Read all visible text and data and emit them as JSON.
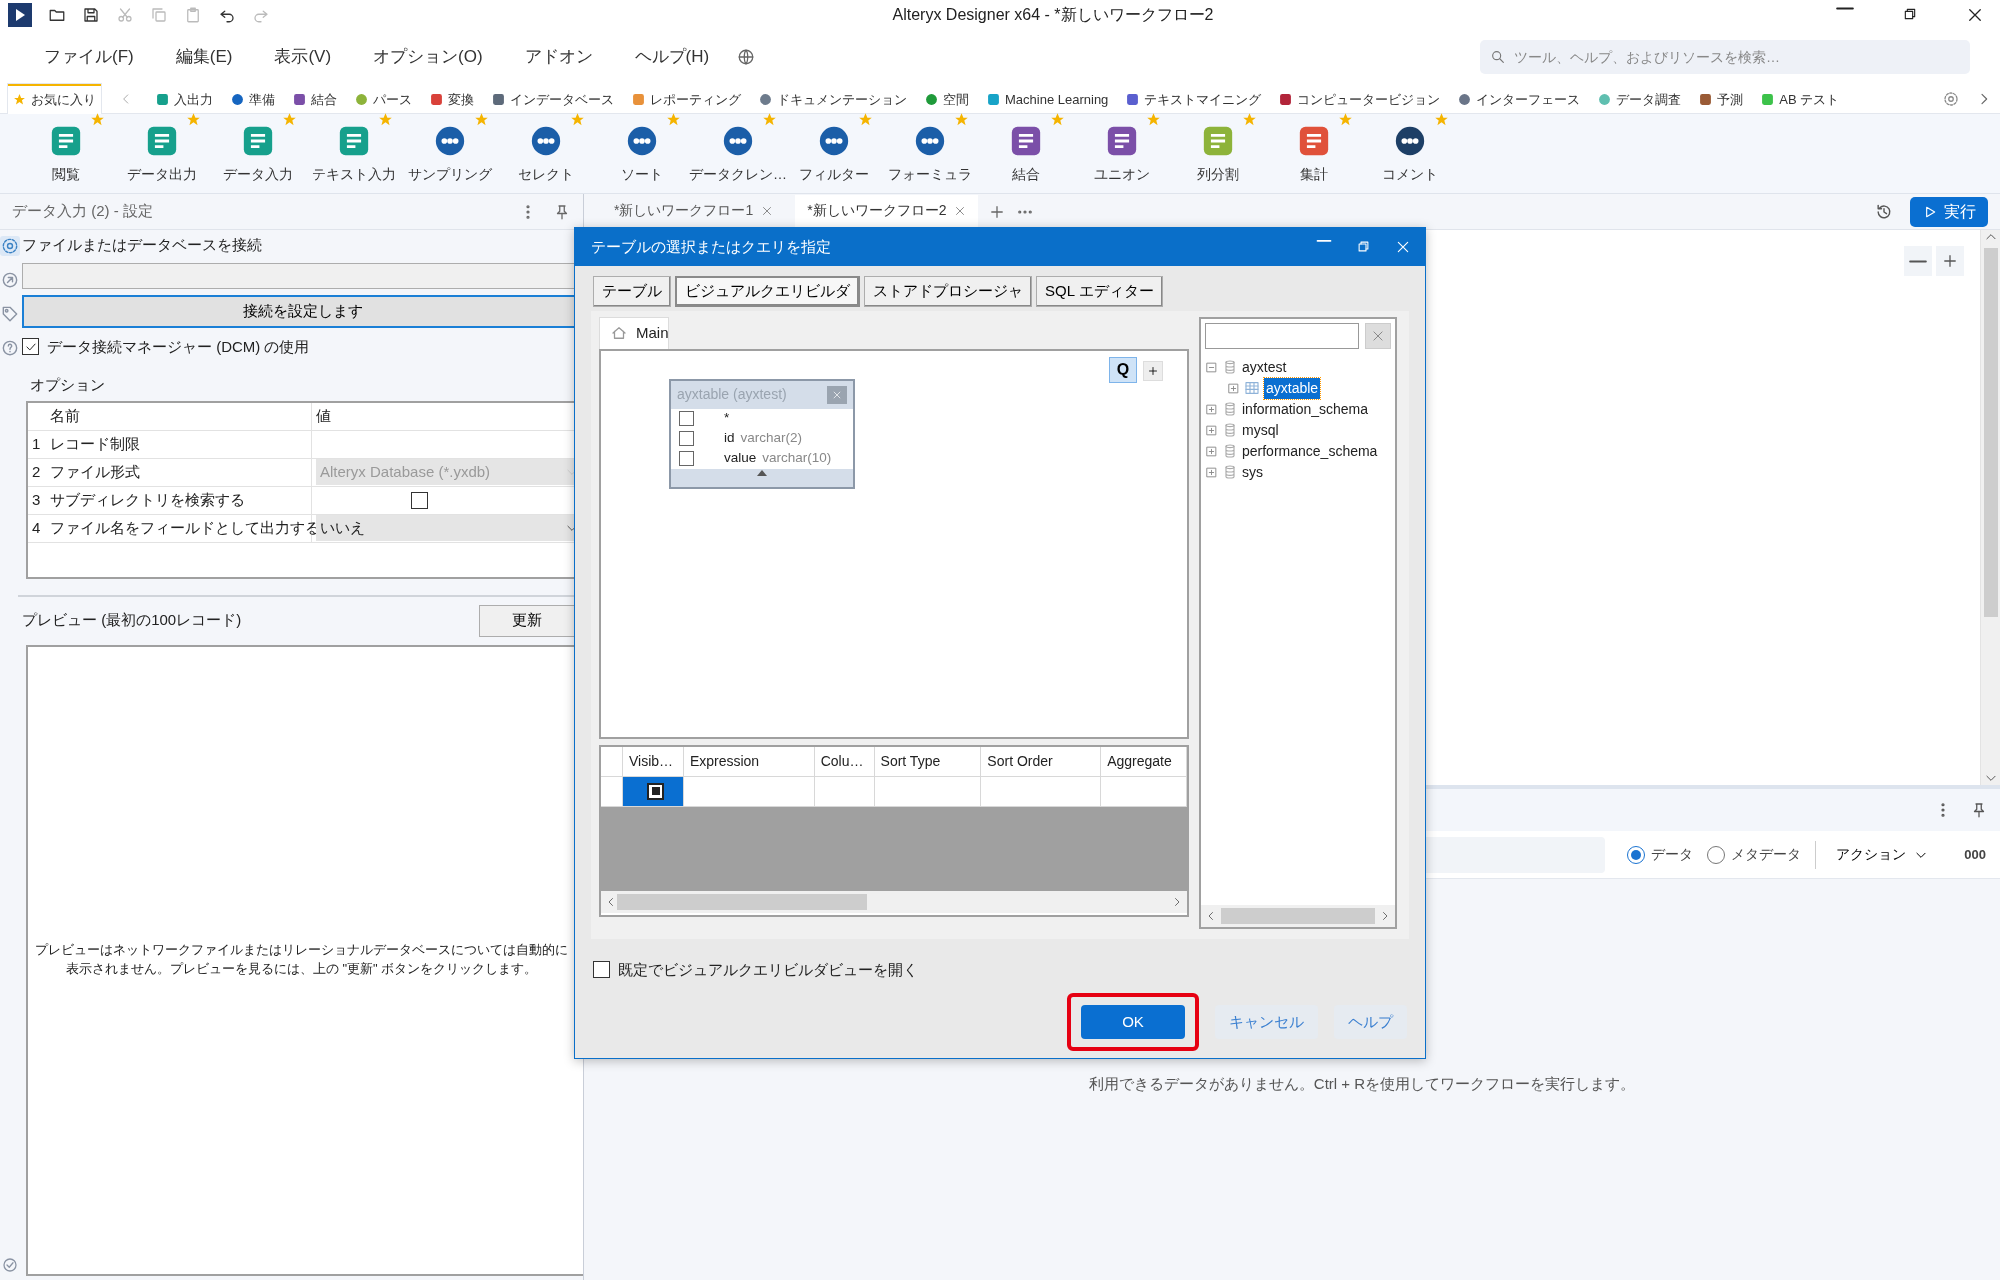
{
  "window": {
    "title": "Alteryx Designer x64 - *新しいワークフロー2"
  },
  "quick_access": [
    {
      "kind": "folder",
      "disabled": false
    },
    {
      "kind": "save",
      "disabled": false
    },
    {
      "kind": "cut",
      "disabled": true
    },
    {
      "kind": "copy",
      "disabled": true
    },
    {
      "kind": "paste",
      "disabled": true
    },
    {
      "kind": "undo",
      "disabled": false
    },
    {
      "kind": "redo",
      "disabled": true
    }
  ],
  "menu": [
    "ファイル(F)",
    "編集(E)",
    "表示(V)",
    "オプション(O)",
    "アドオン",
    "ヘルプ(H)"
  ],
  "search": {
    "placeholder": "ツール、ヘルプ、およびリソースを検索…"
  },
  "categories": [
    {
      "label": "お気に入り",
      "kind": "star",
      "color": "#f5b400",
      "selected": true
    },
    {
      "label": "入出力",
      "kind": "square",
      "color": "#16a08c",
      "selected": false
    },
    {
      "label": "準備",
      "kind": "circle",
      "color": "#1565c0",
      "selected": false
    },
    {
      "label": "結合",
      "kind": "square",
      "color": "#7b4fa8",
      "selected": false
    },
    {
      "label": "パース",
      "kind": "circle",
      "color": "#8db33a",
      "selected": false
    },
    {
      "label": "変換",
      "kind": "square",
      "color": "#d9413a",
      "selected": false
    },
    {
      "label": "インデータベース",
      "kind": "square",
      "color": "#5d6a7a",
      "selected": false
    },
    {
      "label": "レポーティング",
      "kind": "square",
      "color": "#e8913a",
      "selected": false
    },
    {
      "label": "ドキュメンテーション",
      "kind": "circle",
      "color": "#6d7b8c",
      "selected": false
    },
    {
      "label": "空間",
      "kind": "circle",
      "color": "#1f9a3a",
      "selected": false
    },
    {
      "label": "Machine Learning",
      "kind": "square",
      "color": "#17a3c7",
      "selected": false
    },
    {
      "label": "テキストマイニング",
      "kind": "square",
      "color": "#5a5fcf",
      "selected": false
    },
    {
      "label": "コンピュータービジョン",
      "kind": "square",
      "color": "#b2253a",
      "selected": false
    },
    {
      "label": "インターフェース",
      "kind": "circle",
      "color": "#6a7588",
      "selected": false
    },
    {
      "label": "データ調査",
      "kind": "circle",
      "color": "#5fbfb0",
      "selected": false
    },
    {
      "label": "予測",
      "kind": "square",
      "color": "#9a5b36",
      "selected": false
    },
    {
      "label": "AB テスト",
      "kind": "square",
      "color": "#3cc24a",
      "selected": false
    }
  ],
  "tools": [
    {
      "label": "閲覧",
      "kind": "square",
      "color": "#16a08c"
    },
    {
      "label": "データ出力",
      "kind": "square",
      "color": "#16a08c"
    },
    {
      "label": "データ入力",
      "kind": "square",
      "color": "#16a08c"
    },
    {
      "label": "テキスト入力",
      "kind": "square",
      "color": "#16a08c"
    },
    {
      "label": "サンプリング",
      "kind": "circle",
      "color": "#1b5ea8"
    },
    {
      "label": "セレクト",
      "kind": "circle",
      "color": "#1b5ea8"
    },
    {
      "label": "ソート",
      "kind": "circle",
      "color": "#1b5ea8"
    },
    {
      "label": "データクレン…",
      "kind": "circle",
      "color": "#1b5ea8"
    },
    {
      "label": "フィルター",
      "kind": "circle",
      "color": "#1b5ea8"
    },
    {
      "label": "フォーミュラ",
      "kind": "circle",
      "color": "#1b5ea8"
    },
    {
      "label": "結合",
      "kind": "square",
      "color": "#7b4fa8"
    },
    {
      "label": "ユニオン",
      "kind": "square",
      "color": "#7b4fa8"
    },
    {
      "label": "列分割",
      "kind": "square",
      "color": "#8db33a"
    },
    {
      "label": "集計",
      "kind": "square",
      "color": "#e0513a"
    },
    {
      "label": "コメント",
      "kind": "circle",
      "color": "#1d3f66"
    }
  ],
  "settings_panel": {
    "title": "データ入力 (2) - 設定",
    "side_icons": [
      {
        "kind": "gear",
        "selected": true
      },
      {
        "kind": "arrow",
        "selected": false
      },
      {
        "kind": "tag",
        "selected": false
      },
      {
        "kind": "help",
        "selected": false
      }
    ],
    "connect_label": "ファイルまたはデータベースを接続",
    "connect_button": "接続を設定します",
    "dcm": {
      "label": "データ接続マネージャー (DCM) の使用",
      "checked": true
    },
    "options_label": "オプション",
    "options_table": {
      "columns": [
        "名前",
        "値"
      ],
      "rows": [
        {
          "index": "1",
          "name": "レコード制限",
          "kind": "empty"
        },
        {
          "index": "2",
          "name": "ファイル形式",
          "kind": "dropdown",
          "value": "Alteryx Database (*.yxdb)",
          "disabled": true
        },
        {
          "index": "3",
          "name": "サブディレクトリを検索する",
          "kind": "checkbox",
          "checked": false
        },
        {
          "index": "4",
          "name": "ファイル名をフィールドとして出力する",
          "kind": "dropdown",
          "value": "いいえ",
          "disabled": false
        }
      ]
    },
    "preview_label": "プレビュー (最初の100レコード)",
    "refresh_button": "更新",
    "preview_message": "プレビューはネットワークファイルまたはリレーショナルデータベースについては自動的に表示されません。プレビューを見るには、上の \"更新\" ボタンをクリックします。"
  },
  "workflow_tabs": [
    {
      "label": "*新しいワークフロー1",
      "selected": false
    },
    {
      "label": "*新しいワークフロー2",
      "selected": true
    }
  ],
  "run_button": "実行",
  "results": {
    "radios": [
      {
        "label": "データ",
        "selected": true
      },
      {
        "label": "メタデータ",
        "selected": false
      }
    ],
    "action": "アクション",
    "count": "000",
    "message": "利用できるデータがありません。Ctrl + Rを使用してワークフローを実行します。"
  },
  "dialog": {
    "title": "テーブルの選択またはクエリを指定",
    "tabs": [
      {
        "label": "テーブル",
        "selected": false
      },
      {
        "label": "ビジュアルクエリビルダ",
        "selected": true
      },
      {
        "label": "ストアドプロシージャ",
        "selected": false
      },
      {
        "label": "SQL エディター",
        "selected": false
      }
    ],
    "inner_tab": "Main",
    "query_button": "Q",
    "table_box": {
      "title": "ayxtable (ayxtest)",
      "fields": [
        {
          "name": "*",
          "checked": false
        },
        {
          "name": "id",
          "type": "varchar(2)",
          "checked": false
        },
        {
          "name": "value",
          "type": "varchar(10)",
          "checked": false
        }
      ]
    },
    "grid": {
      "columns": [
        "Visib…",
        "Expression",
        "Colu…",
        "Sort Type",
        "Sort Order",
        "Aggregate"
      ],
      "rows": [
        {
          "visible_checked": true,
          "selected": true
        }
      ]
    },
    "tree": [
      {
        "label": "ayxtest",
        "expanded": true,
        "selected": false,
        "children": [
          {
            "label": "ayxtable",
            "expanded": false,
            "selected": true
          }
        ]
      },
      {
        "label": "information_schema",
        "expanded": false,
        "selected": false
      },
      {
        "label": "mysql",
        "expanded": false,
        "selected": false
      },
      {
        "label": "performance_schema",
        "expanded": false,
        "selected": false
      },
      {
        "label": "sys",
        "expanded": false,
        "selected": false
      }
    ],
    "default_view": {
      "label": "既定でビジュアルクエリビルダビューを開く",
      "checked": false
    },
    "buttons": [
      {
        "label": "OK",
        "kind": "primary",
        "highlighted": true
      },
      {
        "label": "キャンセル",
        "kind": "secondary",
        "highlighted": false
      },
      {
        "label": "ヘルプ",
        "kind": "secondary",
        "highlighted": false
      }
    ]
  }
}
